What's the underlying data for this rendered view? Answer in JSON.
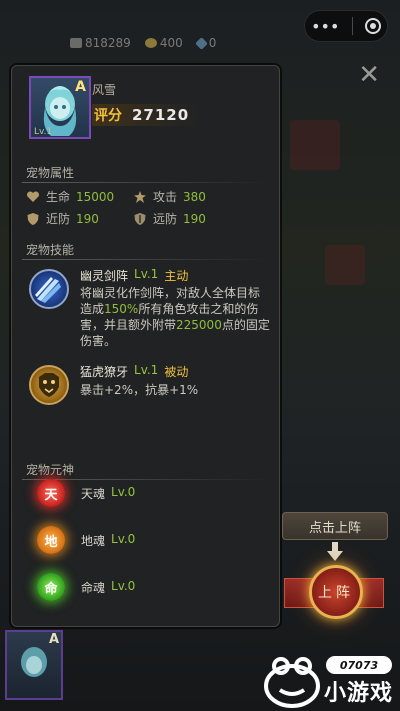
{
  "top_bar": {
    "resources": [
      {
        "icon": "silver-coin-icon",
        "value": "818289"
      },
      {
        "icon": "gold-ingot-icon",
        "value": "400"
      },
      {
        "icon": "diamond-icon",
        "value": "0"
      }
    ]
  },
  "pet": {
    "name": "风雪",
    "grade": "A",
    "level_badge": "Lv.1",
    "score_label": "评分",
    "score_value": "27120"
  },
  "attributes": {
    "title": "宠物属性",
    "items": [
      {
        "icon": "heart-icon",
        "label": "生命",
        "value": "15000"
      },
      {
        "icon": "attack-icon",
        "label": "攻击",
        "value": "380"
      },
      {
        "icon": "melee-defense-icon",
        "label": "近防",
        "value": "190"
      },
      {
        "icon": "ranged-defense-icon",
        "label": "远防",
        "value": "190"
      }
    ]
  },
  "skills": {
    "title": "宠物技能",
    "items": [
      {
        "icon": "sword-formation-icon",
        "name": "幽灵剑阵",
        "level": "Lv.1",
        "type": "主动",
        "desc_1": "将幽灵化作剑阵，对敌人全体目标造成",
        "desc_hl_1": "150%",
        "desc_2": "所有角色攻击之和的伤害，并且额外附带",
        "desc_hl_2": "225000",
        "desc_3": "点的固定伤害。"
      },
      {
        "icon": "tiger-fang-icon",
        "name": "猛虎獠牙",
        "level": "Lv.1",
        "type": "被动",
        "desc": "暴击+2%，抗暴+1%"
      }
    ]
  },
  "souls": {
    "title": "宠物元神",
    "items": [
      {
        "glyph": "天",
        "name": "天魂",
        "level": "Lv.0",
        "color": "#e0302e"
      },
      {
        "glyph": "地",
        "name": "地魂",
        "level": "Lv.0",
        "color": "#e08a1e"
      },
      {
        "glyph": "命",
        "name": "命魂",
        "level": "Lv.0",
        "color": "#4cc42a"
      }
    ]
  },
  "actions": {
    "hint": "点击上阵",
    "deploy": "上阵"
  },
  "bottom_card": {
    "grade": "A"
  },
  "watermark": {
    "badge": "07073",
    "text": "小游戏"
  }
}
